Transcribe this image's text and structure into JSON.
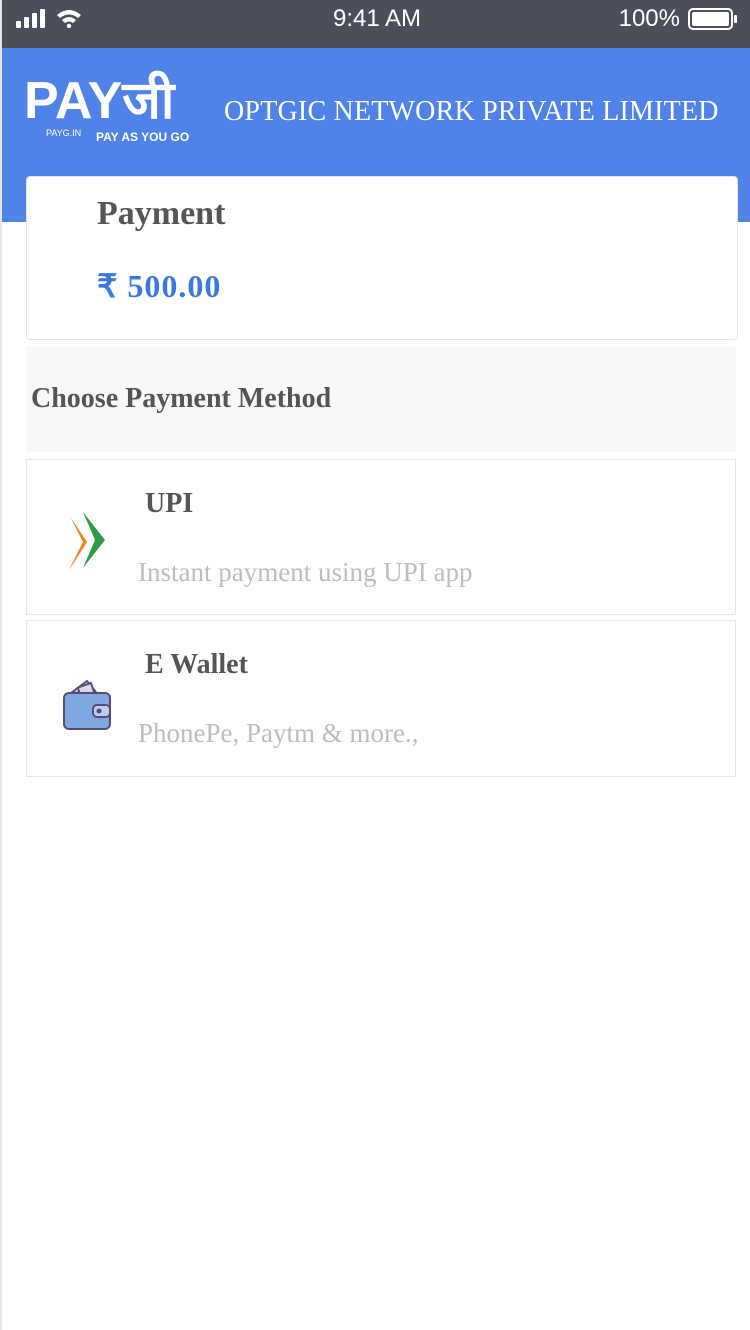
{
  "status_bar": {
    "time": "9:41 AM",
    "battery": "100%"
  },
  "header": {
    "logo_text": "PAYजी",
    "logo_sub_small": "PAYG.IN",
    "logo_sub": "PAY AS YOU GO",
    "company_name": "OPTGIC NETWORK PRIVATE LIMITED",
    "color": "#4f83e8"
  },
  "payment": {
    "title": "Payment",
    "amount": "₹ 500.00",
    "amount_color": "#3a78e0"
  },
  "methods": {
    "header": "Choose Payment Method",
    "options": [
      {
        "title": "UPI",
        "description": "Instant payment using UPI app",
        "icon": "upi-icon"
      },
      {
        "title": "E Wallet",
        "description": "PhonePe, Paytm & more.,",
        "icon": "wallet-icon"
      }
    ]
  }
}
